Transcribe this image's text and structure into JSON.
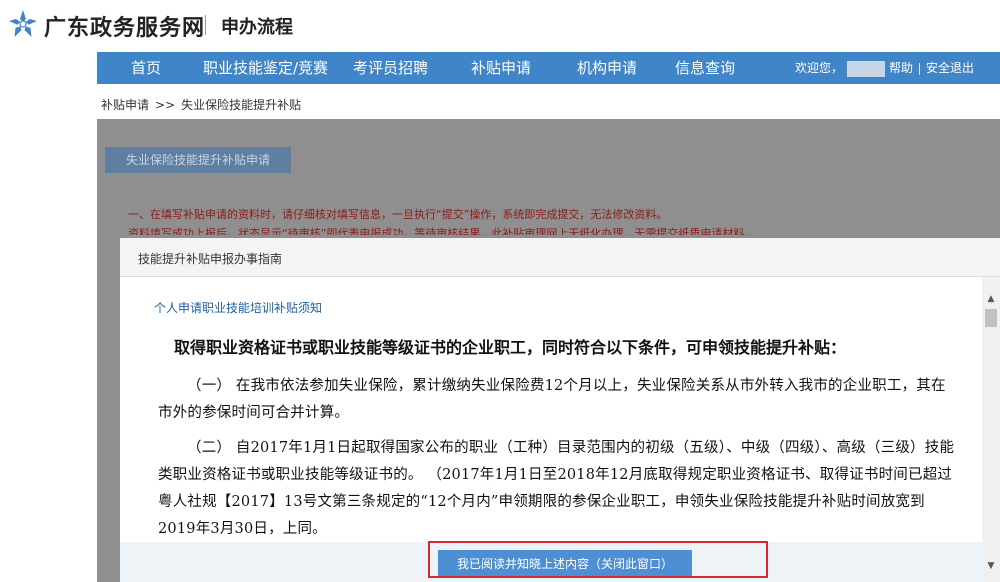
{
  "header": {
    "site_name": "广东政务服务网",
    "subtitle": "申办流程",
    "brand_color": "#3f85c8",
    "logo_icon": "star-flower-icon"
  },
  "nav": {
    "items": [
      "首页",
      "职业技能鉴定/竞赛",
      "考评员招聘",
      "补贴申请",
      "机构申请",
      "信息查询"
    ],
    "welcome": "欢迎您，",
    "help": "帮助",
    "logout": "安全退出"
  },
  "breadcrumb": {
    "parent": "补贴申请",
    "separator": ">>",
    "current": "失业保险技能提升补贴"
  },
  "background": {
    "apply_button": "失业保险技能提升补贴申请",
    "notice_1": "一、在填写补贴申请的资料时，请仔细核对填写信息，一旦执行“提交”操作，系统即完成提交，无法修改资料。",
    "notice_2": "资料填写成功上报后，状态显示“待审核”即代表申报成功，等待审核结果。此补贴审理网上无纸化办理，无需提交纸质申请材料。"
  },
  "dialog": {
    "title": "技能提升补贴申报办事指南",
    "section_heading": "个人申请职业技能培训补贴须知",
    "lead": "取得职业资格证书或职业技能等级证书的企业职工，同时符合以下条件，可申领技能提升补贴：",
    "para_1": "（一） 在我市依法参加失业保险，累计缴纳失业保险费12个月以上，失业保险关系从市外转入我市的企业职工，其在市外的参保时间可合并计算。",
    "para_2": "（二） 自2017年1月1日起取得国家公布的职业（工种）目录范围内的初级（五级）、中级（四级）、高级（三级）技能类职业资格证书或职业技能等级证书的。 （2017年1月1日至2018年12月底取得规定职业资格证书、取得证书时间已超过粤人社规【2017】13号文第三条规定的“12个月内”申领期限的参保企业职工，申领失业保险技能提升补贴时间放宽到2019年3月30日，上同。",
    "confirm_button": "我已阅读并知晓上述内容（关闭此窗口）",
    "highlight_color": "#d9282f"
  }
}
